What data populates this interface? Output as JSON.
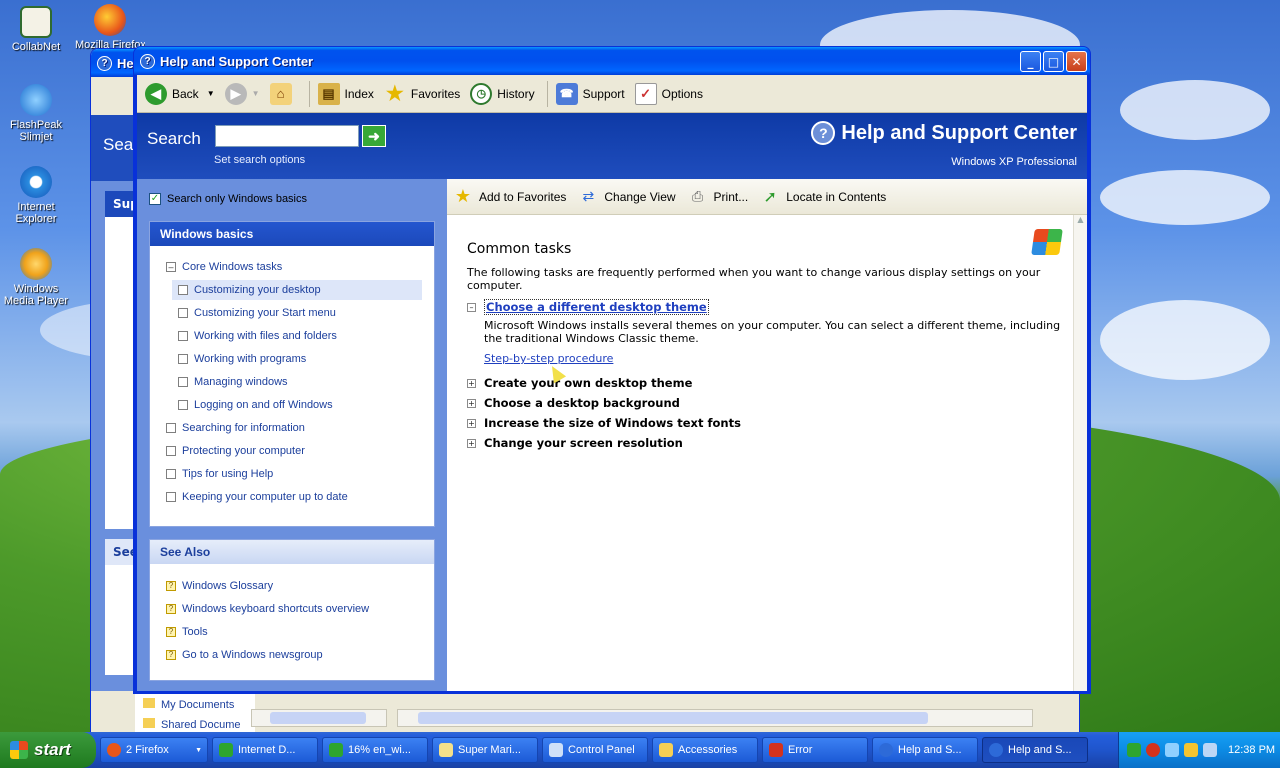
{
  "desktop": {
    "icons": [
      {
        "label": "CollabNet"
      },
      {
        "label": "Mozilla Firefox"
      },
      {
        "label": "FlashPeak Slimjet"
      },
      {
        "label": "Internet Explorer"
      },
      {
        "label": "Windows Media Player"
      }
    ]
  },
  "back_window": {
    "title": "He",
    "search_label": "Sea",
    "box_heading_1": "Sup",
    "box_heading_2": "See",
    "folders": [
      "My Documents",
      "Shared Docume"
    ]
  },
  "window": {
    "title": "Help and Support Center",
    "toolbar": {
      "back": "Back",
      "index": "Index",
      "favorites": "Favorites",
      "history": "History",
      "support": "Support",
      "options": "Options"
    },
    "header": {
      "search_label": "Search",
      "search_value": "",
      "search_options": "Set search options",
      "brand_title": "Help and Support Center",
      "brand_subtitle": "Windows XP Professional"
    },
    "left": {
      "search_only_label": "Search only Windows basics",
      "search_only_checked": true,
      "basics_heading": "Windows basics",
      "basics_items": [
        "Core Windows tasks",
        "Customizing your desktop",
        "Customizing your Start menu",
        "Working with files and folders",
        "Working with programs",
        "Managing windows",
        "Logging on and off Windows",
        "Searching for information",
        "Protecting your computer",
        "Tips for using Help",
        "Keeping your computer up to date"
      ],
      "see_also_heading": "See Also",
      "see_also_items": [
        "Windows Glossary",
        "Windows keyboard shortcuts overview",
        "Tools",
        "Go to a Windows newsgroup"
      ]
    },
    "content_toolbar": {
      "add_favorites": "Add to Favorites",
      "change_view": "Change View",
      "print": "Print...",
      "locate": "Locate in Contents"
    },
    "content": {
      "heading": "Common tasks",
      "intro": "The following tasks are frequently performed when you want to change various display settings on your computer.",
      "expanded_task": "Choose a different desktop theme",
      "expanded_desc": "Microsoft Windows installs several themes on your computer. You can select a different theme, including the traditional Windows Classic theme.",
      "step_link": "Step-by-step procedure",
      "tasks": [
        "Create your own desktop theme",
        "Choose a desktop background",
        "Increase the size of Windows text fonts",
        "Change your screen resolution"
      ]
    }
  },
  "taskbar": {
    "start": "start",
    "items": [
      "2 Firefox",
      "Internet D...",
      "16% en_wi...",
      "Super Mari...",
      "Control Panel",
      "Accessories",
      "Error",
      "Help and S...",
      "Help and S..."
    ],
    "clock": "12:38 PM"
  }
}
